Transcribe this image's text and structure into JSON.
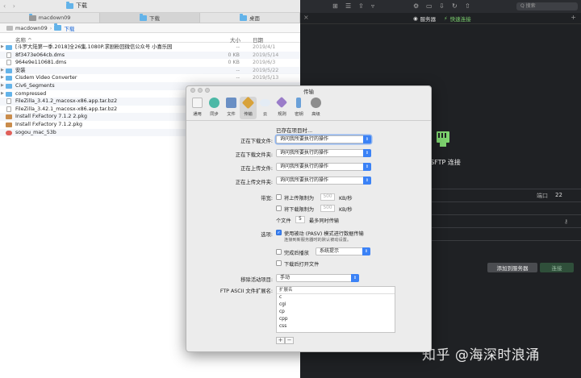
{
  "finder": {
    "tabs": [
      {
        "label": "macdown09"
      },
      {
        "label": "下载"
      },
      {
        "label": "桌面"
      }
    ],
    "window_title": "下载",
    "path": {
      "root": "macdown09",
      "current": "下载"
    },
    "columns": {
      "name": "名称",
      "size": "大小",
      "date": "日期"
    },
    "files": [
      {
        "name": "[斗罗大陆第一季.2018]全26集.1080P.求剧粉回微信公众号 小喜乐园",
        "size": "--",
        "date": "2019/4/1",
        "kind": "folder",
        "expand": true
      },
      {
        "name": "8f3473e064cb.dms",
        "size": "0 KB",
        "date": "2019/5/14",
        "kind": "file",
        "expand": false
      },
      {
        "name": "964e9e110681.dms",
        "size": "0 KB",
        "date": "2019/6/3",
        "kind": "file",
        "expand": false
      },
      {
        "name": "安装",
        "size": "--",
        "date": "2019/5/22",
        "kind": "folder",
        "expand": true
      },
      {
        "name": "Cisdem Video Converter",
        "size": "--",
        "date": "2019/5/13",
        "kind": "folder",
        "expand": true
      },
      {
        "name": "Civ6_Segments",
        "size": "",
        "date": "",
        "kind": "folder",
        "expand": true
      },
      {
        "name": "compressed",
        "size": "",
        "date": "",
        "kind": "folder",
        "expand": true
      },
      {
        "name": "FileZilla_3.41.2_macosx-x86.app.tar.bz2",
        "size": "",
        "date": "",
        "kind": "file",
        "expand": false
      },
      {
        "name": "FileZilla_3.42.1_macosx-x86.app.tar.bz2",
        "size": "",
        "date": "",
        "kind": "file",
        "expand": false
      },
      {
        "name": "Install FxFactory 7.1.2 2.pkg",
        "size": "",
        "date": "",
        "kind": "pkg",
        "expand": false
      },
      {
        "name": "Install FxFactory 7.1.2.pkg",
        "size": "",
        "date": "",
        "kind": "pkg",
        "expand": false
      },
      {
        "name": "sogou_mac_53b",
        "size": "",
        "date": "",
        "kind": "app",
        "expand": false
      }
    ]
  },
  "topbar": {
    "search_placeholder": "Q 搜索",
    "servers_tab": "服务器",
    "quick_connect_tab": "快速连接"
  },
  "dark_panel": {
    "sftp_label": "SFTP 连接",
    "port_label": "端口",
    "port_value": "22",
    "add_server_button": "添加到服务器",
    "connect_button": "连接",
    "watermark": "知乎 @海深时浪涌"
  },
  "dialog": {
    "title": "传输",
    "toolbar": [
      {
        "label": "通用",
        "icon": "switch-icon",
        "color": "#f2f2f2"
      },
      {
        "label": "同步",
        "icon": "sync-icon",
        "color": "#4cb8a6"
      },
      {
        "label": "文件",
        "icon": "file-icon",
        "color": "#6a8fc4"
      },
      {
        "label": "传输",
        "icon": "transfer-icon",
        "color": "#d8a23a"
      },
      {
        "label": "云",
        "icon": "cloud-icon",
        "color": "#e4ecf5"
      },
      {
        "label": "规则",
        "icon": "rules-icon",
        "color": "#9a7cc9"
      },
      {
        "label": "密钥",
        "icon": "key-icon",
        "color": "#6aa0d8"
      },
      {
        "label": "高级",
        "icon": "gear-icon",
        "color": "#8d8d8d"
      }
    ],
    "existing_header": "已存在项目时...",
    "existing": [
      {
        "label": "正在下载文件:",
        "value": "询问我所要执行的操作"
      },
      {
        "label": "正在下载文件夹:",
        "value": "询问我所要执行的操作"
      },
      {
        "label": "正在上传文件:",
        "value": "询问我所要执行的操作"
      },
      {
        "label": "正在上传文件夹:",
        "value": "询问我所要执行的操作"
      }
    ],
    "bandwidth": {
      "label": "带宽:",
      "upload_text": "将上传限制为",
      "upload_value": "500",
      "download_text": "将下载限制为",
      "download_value": "500",
      "unit": "KB/秒",
      "concurrent_prefix": "个文件",
      "concurrent_value": "5",
      "concurrent_suffix": "最多同时传输"
    },
    "options": {
      "label": "选项:",
      "passive_text": "使用被动 (PASV) 模式进行数据传输",
      "passive_note": "连接到新服务器时的默认被动设置。",
      "sound_text": "完成后播放",
      "sound_value": "系统提示",
      "open_text": "下载后打开文件"
    },
    "remove": {
      "label": "移除活动项目:",
      "value": "手动"
    },
    "ftp_ascii": {
      "label": "FTP ASCII 文件扩展名:",
      "column": "扩展名",
      "items": [
        "c",
        "cgi",
        "cp",
        "cpp",
        "css"
      ]
    },
    "add_button": "+",
    "remove_button": "−"
  }
}
